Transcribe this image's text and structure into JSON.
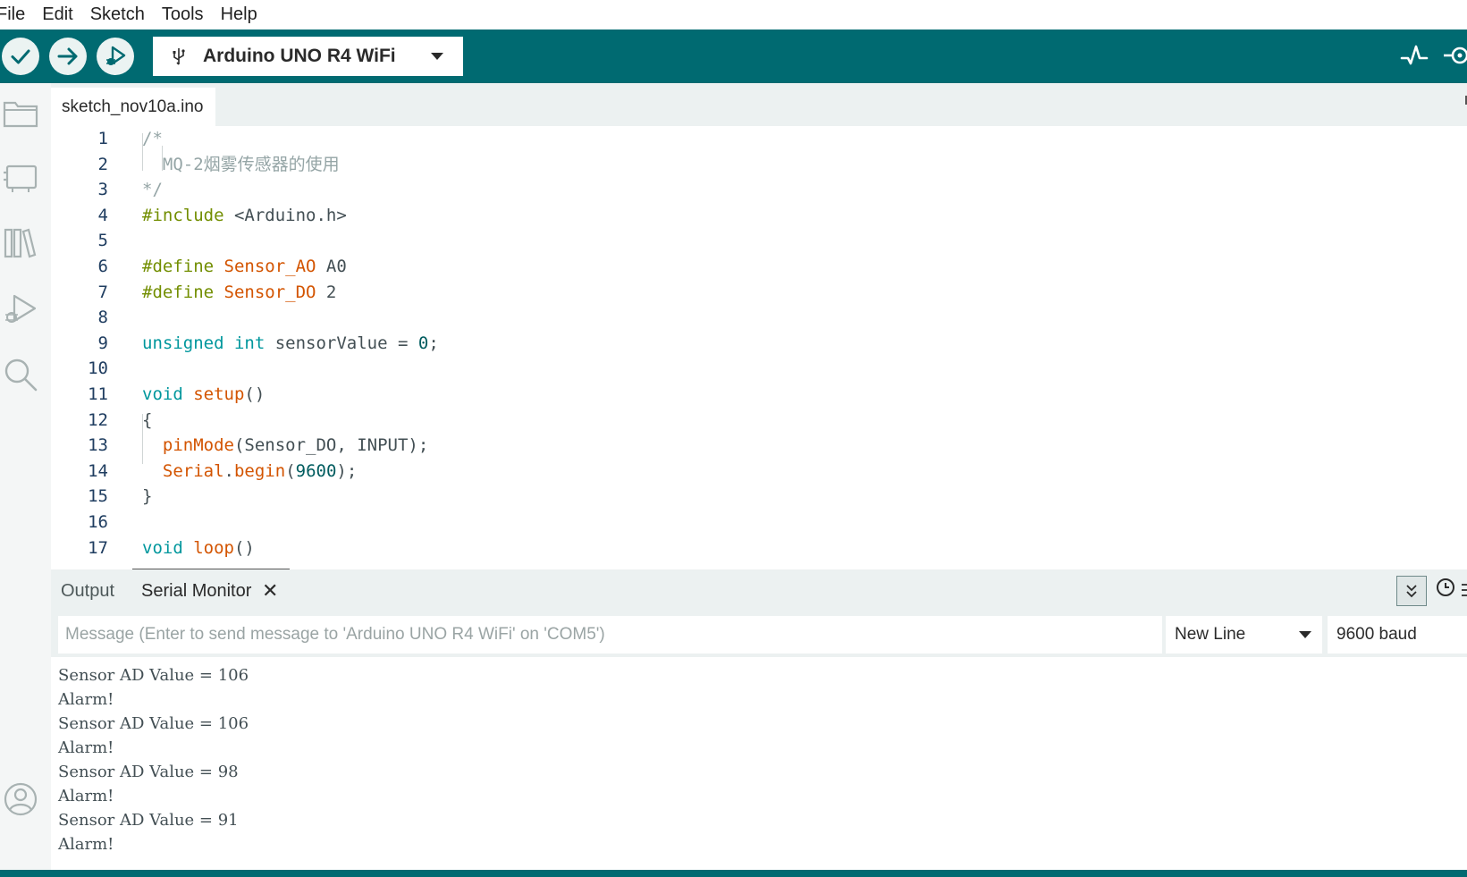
{
  "menu": [
    "File",
    "Edit",
    "Sketch",
    "Tools",
    "Help"
  ],
  "toolbar": {
    "verify_icon": "check-icon",
    "upload_icon": "arrow-right-icon",
    "debug_icon": "debugger-icon",
    "board_name": "Arduino UNO R4 WiFi",
    "board_icon": "usb-icon",
    "serial_plotter_icon": "pulse-icon",
    "serial_monitor_icon": "magnifier-icon"
  },
  "sidebar": [
    "folder-icon",
    "board-manager-icon",
    "library-icon",
    "debug-icon",
    "search-icon",
    "account-icon"
  ],
  "tab": {
    "filename": "sketch_nov10a.ino"
  },
  "code": [
    {
      "n": "1",
      "parts": [
        [
          "c-comment",
          "/*"
        ]
      ]
    },
    {
      "n": "2",
      "parts": [
        [
          "c-comment",
          "  MQ-2烟雾传感器的使用"
        ]
      ]
    },
    {
      "n": "3",
      "parts": [
        [
          "c-comment",
          "*/"
        ]
      ]
    },
    {
      "n": "4",
      "parts": [
        [
          "c-pre",
          "#include"
        ],
        [
          "c-plain",
          " <Arduino.h>"
        ]
      ]
    },
    {
      "n": "5",
      "parts": []
    },
    {
      "n": "6",
      "parts": [
        [
          "c-pre",
          "#define"
        ],
        [
          "c-plain",
          " "
        ],
        [
          "c-macro",
          "Sensor_AO"
        ],
        [
          "c-plain",
          " A0"
        ]
      ]
    },
    {
      "n": "7",
      "parts": [
        [
          "c-pre",
          "#define"
        ],
        [
          "c-plain",
          " "
        ],
        [
          "c-macro",
          "Sensor_DO"
        ],
        [
          "c-plain",
          " 2"
        ]
      ]
    },
    {
      "n": "8",
      "parts": []
    },
    {
      "n": "9",
      "parts": [
        [
          "c-kw",
          "unsigned int"
        ],
        [
          "c-plain",
          " sensorValue = "
        ],
        [
          "c-num",
          "0"
        ],
        [
          "c-plain",
          ";"
        ]
      ]
    },
    {
      "n": "10",
      "parts": []
    },
    {
      "n": "11",
      "parts": [
        [
          "c-kw",
          "void"
        ],
        [
          "c-plain",
          " "
        ],
        [
          "c-fn",
          "setup"
        ],
        [
          "c-plain",
          "()"
        ]
      ]
    },
    {
      "n": "12",
      "parts": [
        [
          "c-plain",
          "{"
        ]
      ]
    },
    {
      "n": "13",
      "parts": [
        [
          "c-plain",
          "  "
        ],
        [
          "c-fn",
          "pinMode"
        ],
        [
          "c-plain",
          "(Sensor_DO, INPUT);"
        ]
      ]
    },
    {
      "n": "14",
      "parts": [
        [
          "c-plain",
          "  "
        ],
        [
          "c-fn",
          "Serial"
        ],
        [
          "c-plain",
          "."
        ],
        [
          "c-fn",
          "begin"
        ],
        [
          "c-plain",
          "("
        ],
        [
          "c-num",
          "9600"
        ],
        [
          "c-plain",
          ");"
        ]
      ]
    },
    {
      "n": "15",
      "parts": [
        [
          "c-plain",
          "}"
        ]
      ]
    },
    {
      "n": "16",
      "parts": []
    },
    {
      "n": "17",
      "parts": [
        [
          "c-kw",
          "void"
        ],
        [
          "c-plain",
          " "
        ],
        [
          "c-fn",
          "loop"
        ],
        [
          "c-plain",
          "()"
        ]
      ]
    }
  ],
  "panel": {
    "tabs": [
      "Output",
      "Serial Monitor"
    ],
    "close_symbol": "✕",
    "message_placeholder": "Message (Enter to send message to 'Arduino UNO R4 WiFi' on 'COM5')",
    "line_ending": "New Line",
    "baud": "9600 baud",
    "serial_output": [
      "Sensor AD Value = 106",
      "Alarm!",
      "Sensor AD Value = 106",
      "Alarm!",
      "Sensor AD Value = 98",
      "Alarm!",
      "Sensor AD Value = 91",
      "Alarm!"
    ]
  },
  "colors": {
    "toolbar": "#006a71",
    "panel_bg": "#ecf1f1"
  }
}
